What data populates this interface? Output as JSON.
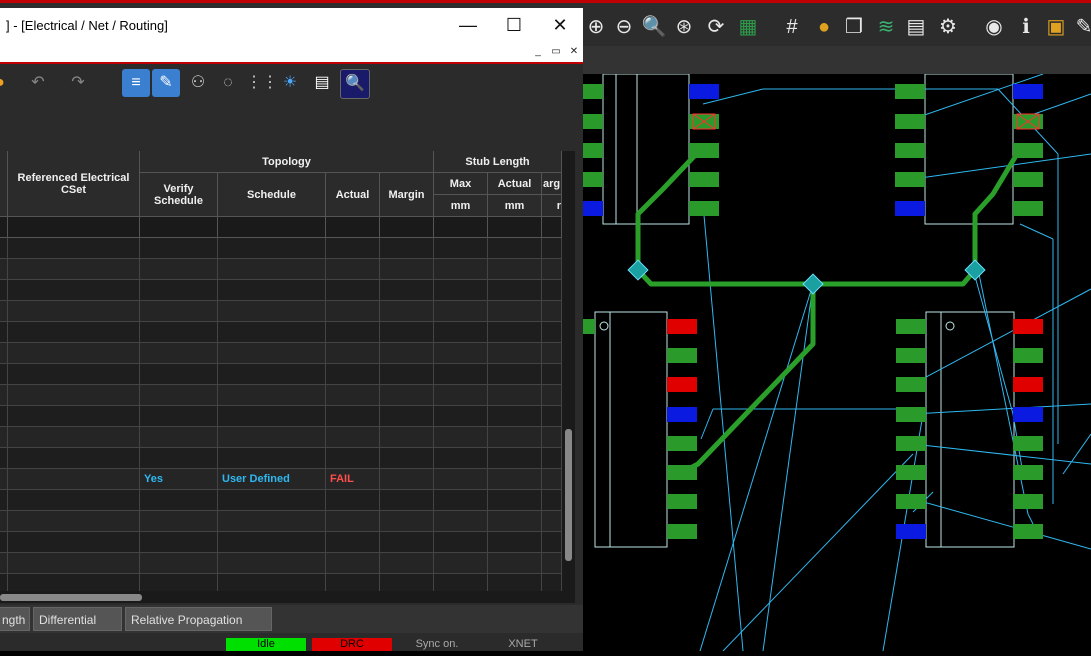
{
  "window": {
    "title": "] - [Electrical / Net / Routing]",
    "sub_buttons": [
      "_",
      "▭",
      "✕"
    ]
  },
  "grid": {
    "header": {
      "referenced_cset": "Referenced Electrical CSet",
      "topology": "Topology",
      "stub_length": "Stub Length",
      "verify_schedule": "Verify Schedule",
      "schedule": "Schedule",
      "actual": "Actual",
      "margin": "Margin",
      "max": "Max",
      "stub_actual": "Actual",
      "arg": "arg",
      "mm": "mm",
      "stub_mm": "mm",
      "cut": "r"
    },
    "filter": "*",
    "highlight_row": {
      "verify_schedule": "Yes",
      "schedule": "User Defined",
      "actual": "FAIL"
    }
  },
  "tabs": [
    "ngth",
    "Differential Pair",
    "Relative Propagation Delay"
  ],
  "status": {
    "idle": "Idle",
    "drc": "DRC",
    "sync": "Sync on.",
    "xnet": "XNET"
  },
  "colors": {
    "trace": "#2aa02a",
    "ratsnest": "#2fb8f0",
    "pad_green": "#2a9a2a",
    "pad_red": "#e00000",
    "pad_blue": "#0a1ae0",
    "fail": "#ff4d4d",
    "link": "#2fb8f0",
    "idle": "#00e000",
    "drc": "#e00000"
  }
}
